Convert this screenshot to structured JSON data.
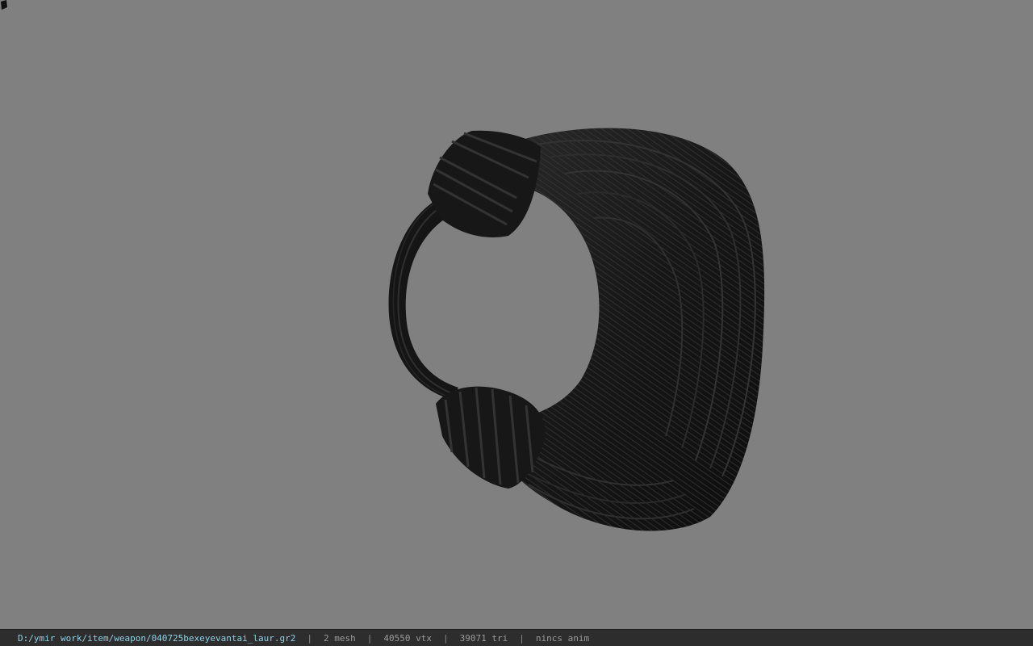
{
  "statusbar": {
    "file_path": "D:/ymir work/item/weapon/040725bexeyevantai_laur.gr2",
    "separator": "|",
    "mesh_count": "2 mesh",
    "vertex_count": "40550 vtx",
    "triangle_count": "39071 tri",
    "anim_status": "nincs anim"
  },
  "viewport": {
    "background_color": "#808080",
    "model_color": "#1a1a1a",
    "model_icon": "rope-coil-3d-model",
    "marker_icon": "pivot-marker-icon"
  }
}
